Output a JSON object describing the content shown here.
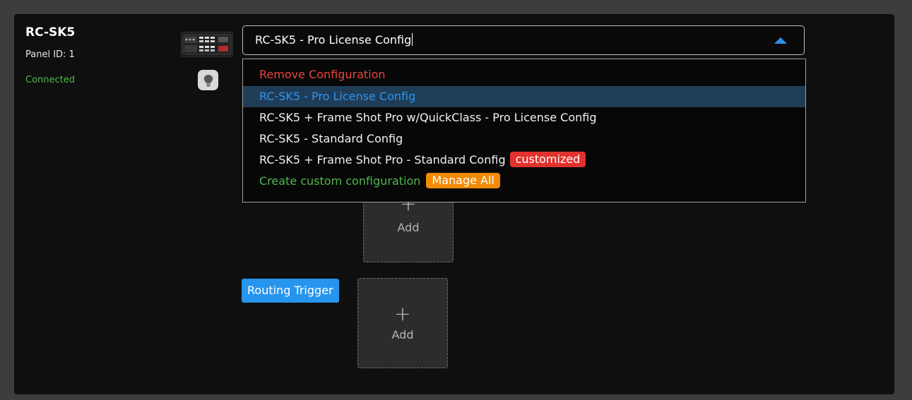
{
  "device": {
    "name": "RC-SK5",
    "panel_id": "Panel ID: 1",
    "status": "Connected",
    "image_icon": "rc-sk5-panel-icon",
    "hint_icon": "lightbulb-icon"
  },
  "config_select": {
    "value": "RC-SK5 - Pro License Config",
    "arrow_icon": "caret-up-icon"
  },
  "dropdown": {
    "remove": "Remove Configuration",
    "options": [
      "RC-SK5 - Pro License Config",
      "RC-SK5 + Frame Shot Pro w/QuickClass - Pro License Config",
      "RC-SK5 - Standard Config",
      "RC-SK5 + Frame Shot Pro - Standard Config"
    ],
    "customized_badge": "customized",
    "create_custom": "Create custom configuration",
    "manage_all": "Manage All"
  },
  "slots": {
    "add_icon": "+",
    "add_label": "Add"
  },
  "routing_trigger": {
    "label": "Routing Trigger"
  },
  "colors": {
    "accent_blue": "#2795ee",
    "connected_green": "#4fb84f",
    "remove_red": "#e8453c",
    "customized_red": "#e2322d",
    "manage_orange": "#f28a05",
    "selected_bg": "#1f3d57"
  }
}
